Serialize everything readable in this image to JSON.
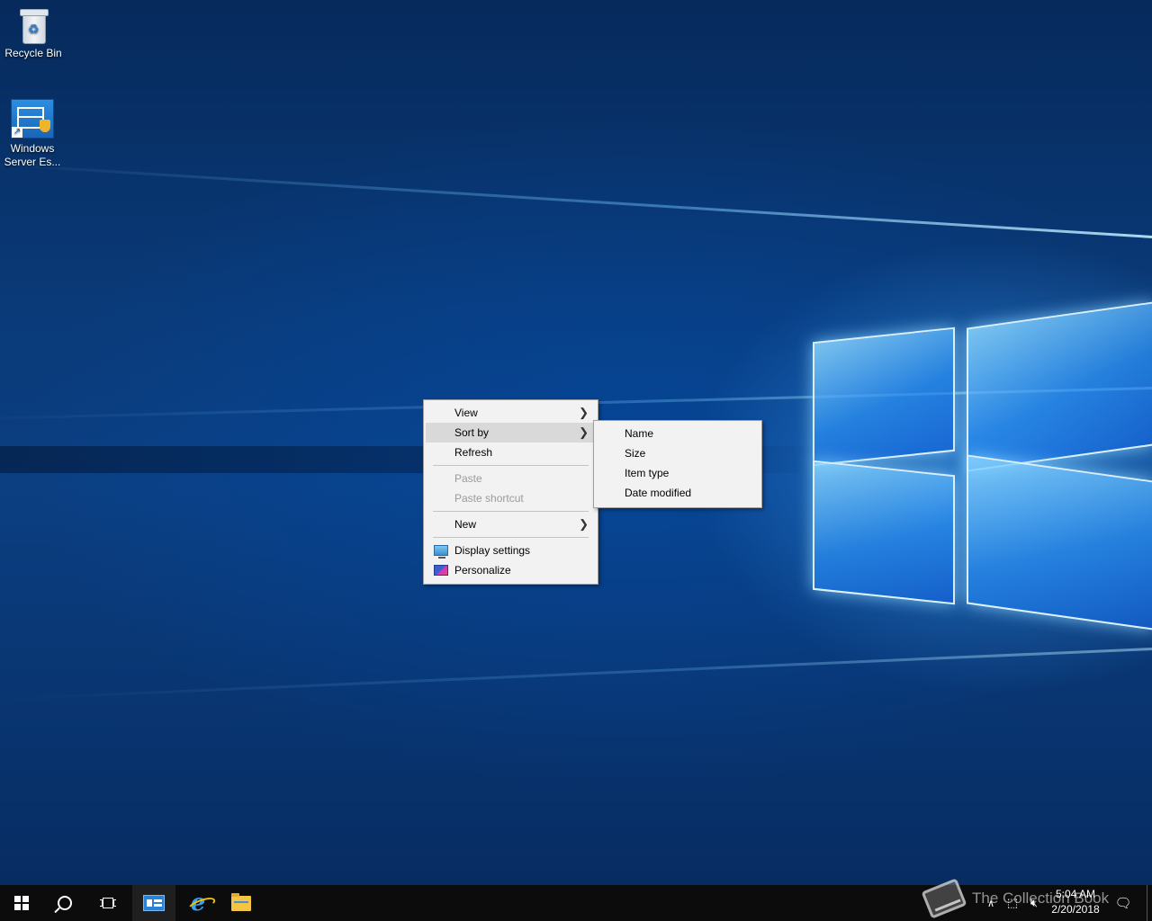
{
  "desktop": {
    "icons": [
      {
        "label": "Recycle Bin",
        "icon": "recycle-bin-icon"
      },
      {
        "label_line1": "Windows",
        "label_line2": "Server Es...",
        "icon": "windows-server-essentials-icon"
      }
    ]
  },
  "context_menu": {
    "items": [
      {
        "label": "View",
        "submenu": true
      },
      {
        "label": "Sort by",
        "submenu": true,
        "highlighted": true
      },
      {
        "label": "Refresh"
      },
      {
        "label": "Paste",
        "disabled": true
      },
      {
        "label": "Paste shortcut",
        "disabled": true
      },
      {
        "label": "New",
        "submenu": true
      },
      {
        "label": "Display settings",
        "icon": "display-settings-icon"
      },
      {
        "label": "Personalize",
        "icon": "personalize-icon"
      }
    ]
  },
  "sort_submenu": {
    "items": [
      "Name",
      "Size",
      "Item type",
      "Date modified"
    ]
  },
  "taskbar": {
    "pinned": [
      "start-icon",
      "search-icon",
      "task-view-icon",
      "server-manager-icon",
      "internet-explorer-icon",
      "file-explorer-icon"
    ],
    "watermark": "The Collection Book",
    "clock": {
      "time": "5:04 AM",
      "date": "2/20/2018"
    }
  },
  "colors": {
    "menu_background": "#f2f2f2",
    "menu_highlight": "#d9d9d9",
    "taskbar": "#0c0c0c",
    "wallpaper_accent": "#1e7fe0"
  }
}
